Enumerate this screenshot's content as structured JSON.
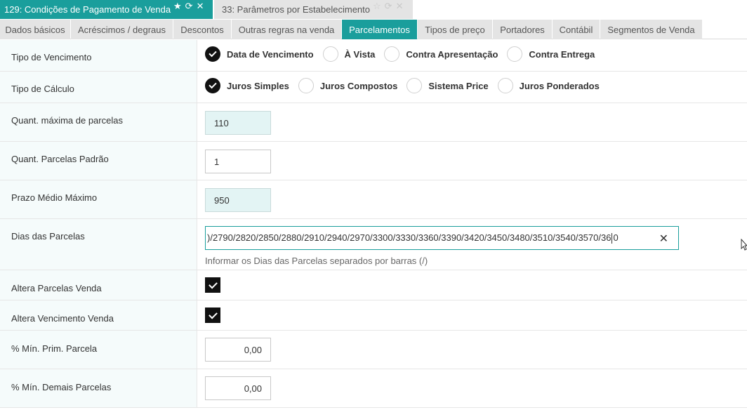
{
  "window_tabs": [
    {
      "label": "129: Condições de Pagamento de Venda",
      "active": true
    },
    {
      "label": "33: Parâmetros por Estabelecimento",
      "active": false
    }
  ],
  "section_tabs": [
    "Dados básicos",
    "Acréscimos / degraus",
    "Descontos",
    "Outras regras na venda",
    "Parcelamentos",
    "Tipos de preço",
    "Portadores",
    "Contábil",
    "Segmentos de Venda"
  ],
  "active_section": "Parcelamentos",
  "form": {
    "tipo_vencimento": {
      "label": "Tipo de Vencimento",
      "options": [
        "Data de Vencimento",
        "À Vista",
        "Contra Apresentação",
        "Contra Entrega"
      ],
      "selected": "Data de Vencimento"
    },
    "tipo_calculo": {
      "label": "Tipo de Cálculo",
      "options": [
        "Juros Simples",
        "Juros Compostos",
        "Sistema Price",
        "Juros Ponderados"
      ],
      "selected": "Juros Simples"
    },
    "quant_maxima": {
      "label": "Quant. máxima de parcelas",
      "value": "110"
    },
    "quant_padrao": {
      "label": "Quant. Parcelas Padrão",
      "value": "1"
    },
    "prazo_medio": {
      "label": "Prazo Médio Máximo",
      "value": "950"
    },
    "dias_parcelas": {
      "label": "Dias das Parcelas",
      "value_before_caret": ")/2790/2820/2850/2880/2910/2940/2970/3300/3330/3360/3390/3420/3450/3480/3510/3540/3570/36",
      "value_after_caret": "0",
      "help": "Informar os Dias das Parcelas separados por barras (/)"
    },
    "altera_parcelas": {
      "label": "Altera Parcelas Venda",
      "checked": true
    },
    "altera_vencimento": {
      "label": "Altera Vencimento Venda",
      "checked": true
    },
    "min_prim": {
      "label": "% Mín. Prim. Parcela",
      "value": "0,00"
    },
    "min_demais": {
      "label": "% Mín. Demais Parcelas",
      "value": "0,00"
    }
  },
  "colors": {
    "accent": "#1a9e9c",
    "label_bg": "#f5fbfb",
    "readonly_bg": "#e3f4f4"
  }
}
